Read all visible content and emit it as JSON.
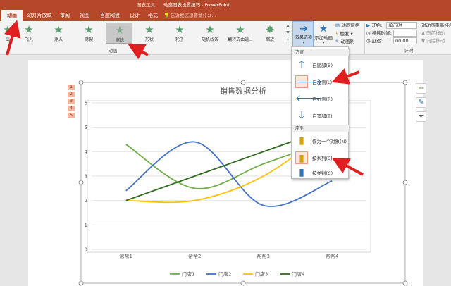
{
  "titlebar": {
    "chart_tools": "图表工具",
    "app_title": "动态图表设置技巧 - PowerPoint"
  },
  "tabs": [
    "动画",
    "幻灯片放映",
    "审阅",
    "视图",
    "百度网盘",
    "设计",
    "格式"
  ],
  "search_placeholder": "告诉我您想要做什么...",
  "ribbon": {
    "effects": [
      "出",
      "飞入",
      "浮入",
      "劈裂",
      "擦除",
      "形状",
      "轮子",
      "随机线条",
      "翻转式由远...",
      "缩放"
    ],
    "selected_effect": "擦除",
    "group_label": "动画",
    "effect_options": "效果选项",
    "add_animation": "添加动画",
    "anim_pane": "动画窗格",
    "trigger": "触发",
    "anim_painter": "动画刷",
    "start_label": "开始:",
    "start_value": "单击时",
    "duration_label": "持续时间:",
    "delay_label": "延迟:",
    "delay_value": "00.00",
    "reorder_title": "对动画重新排序",
    "move_earlier": "向前移动",
    "move_later": "向后移动",
    "timing_label": "计时"
  },
  "dropdown": {
    "direction_header": "方向",
    "directions": [
      "自底部(B)",
      "自左侧(L)",
      "自右侧(R)",
      "自顶部(T)"
    ],
    "sequence_header": "序列",
    "sequences": [
      "作为一个对象(N)",
      "按系列(S)",
      "按类别(C)"
    ],
    "highlighted_direction": "自左侧(L)",
    "highlighted_sequence": "按系列(S)"
  },
  "thumbnails": [
    "1",
    "2",
    "3",
    "4",
    "5"
  ],
  "colors": {
    "accent": "#b7472a",
    "series": [
      "#70ad47",
      "#4472c4",
      "#ffc000",
      "#2f6b1e"
    ]
  },
  "chart_data": {
    "type": "line",
    "title": "销售数据分析",
    "categories": [
      "帮帮1",
      "帮帮2",
      "帮帮3",
      "帮帮4"
    ],
    "series": [
      {
        "name": "门店1",
        "values": [
          4.3,
          2.5,
          3.5,
          4.5
        ]
      },
      {
        "name": "门店2",
        "values": [
          2.4,
          4.4,
          1.8,
          2.8
        ]
      },
      {
        "name": "门店3",
        "values": [
          2.0,
          2.0,
          3.0,
          5.0
        ]
      },
      {
        "name": "门店4",
        "values": [
          2.0,
          3.0,
          4.0,
          5.0
        ]
      }
    ],
    "ylim": [
      0,
      6
    ],
    "yticks": [
      "0",
      "1",
      "2",
      "3",
      "4",
      "5",
      "6"
    ],
    "grid": true,
    "legend": "bottom",
    "smooth": true
  }
}
